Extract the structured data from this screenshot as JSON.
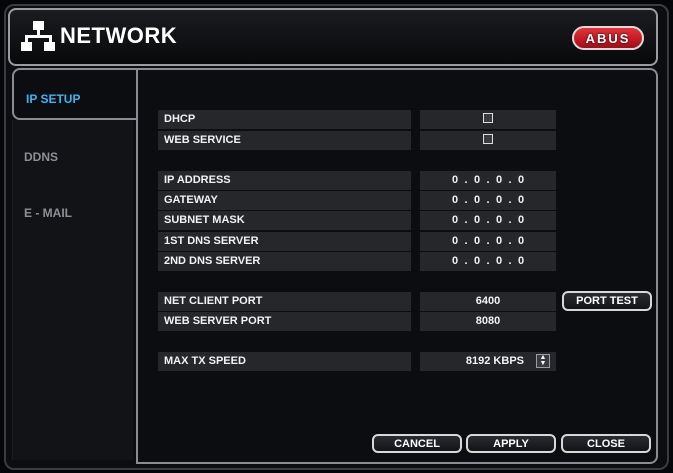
{
  "window": {
    "title": "NETWORK",
    "title_icon": "network-icon",
    "brand": "ABUS"
  },
  "sidebar": {
    "tabs": [
      {
        "label": "IP SETUP",
        "active": true
      },
      {
        "label": "DDNS",
        "active": false
      },
      {
        "label": "E - MAIL",
        "active": false
      }
    ]
  },
  "settings": {
    "dhcp": {
      "label": "DHCP",
      "checked": false
    },
    "web_service": {
      "label": "WEB SERVICE",
      "checked": false
    },
    "ip_address": {
      "label": "IP ADDRESS",
      "octets": [
        "0",
        "0",
        "0",
        "0"
      ]
    },
    "gateway": {
      "label": "GATEWAY",
      "octets": [
        "0",
        "0",
        "0",
        "0"
      ]
    },
    "subnet_mask": {
      "label": "SUBNET MASK",
      "octets": [
        "0",
        "0",
        "0",
        "0"
      ]
    },
    "dns1": {
      "label": "1ST DNS SERVER",
      "octets": [
        "0",
        "0",
        "0",
        "0"
      ]
    },
    "dns2": {
      "label": "2ND DNS SERVER",
      "octets": [
        "0",
        "0",
        "0",
        "0"
      ]
    },
    "net_client_port": {
      "label": "NET CLIENT PORT",
      "value": "6400"
    },
    "web_server_port": {
      "label": "WEB SERVER PORT",
      "value": "8080"
    },
    "max_tx_speed": {
      "label": "MAX TX SPEED",
      "value": "8192 KBPS"
    }
  },
  "buttons": {
    "port_test": "PORT TEST",
    "cancel": "CANCEL",
    "apply": "APPLY",
    "close": "CLOSE"
  },
  "colors": {
    "accent": "#38b6f2",
    "brand_red": "#c81e28",
    "panel": "#0c0d10",
    "field": "#26272b"
  }
}
